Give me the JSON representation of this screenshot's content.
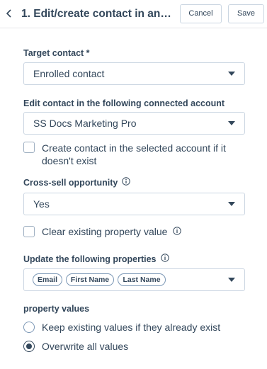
{
  "header": {
    "title": "1. Edit/create contact in anothe...",
    "cancel_label": "Cancel",
    "save_label": "Save"
  },
  "target_contact": {
    "label": "Target contact *",
    "value": "Enrolled contact"
  },
  "connected_account": {
    "label": "Edit contact in the following connected account",
    "value": "SS Docs Marketing Pro",
    "create_checkbox_label": "Create contact in the selected account if it doesn't exist",
    "create_checked": false
  },
  "cross_sell": {
    "label": "Cross-sell opportunity",
    "value": "Yes",
    "clear_checkbox_label": "Clear existing property value",
    "clear_checked": false
  },
  "update_properties": {
    "label": "Update the following properties",
    "tags": [
      "Email",
      "First Name",
      "Last Name"
    ]
  },
  "property_values": {
    "label": "property values",
    "options": [
      {
        "label": "Keep existing values if they already exist",
        "selected": false
      },
      {
        "label": "Overwrite all values",
        "selected": true
      }
    ]
  },
  "icons": {
    "back": "chevron-left-icon",
    "dropdown": "caret-down-icon",
    "info": "info-circle-icon"
  },
  "colors": {
    "text": "#33475b",
    "border": "#cbd6e2",
    "divider": "#e5e8eb"
  }
}
